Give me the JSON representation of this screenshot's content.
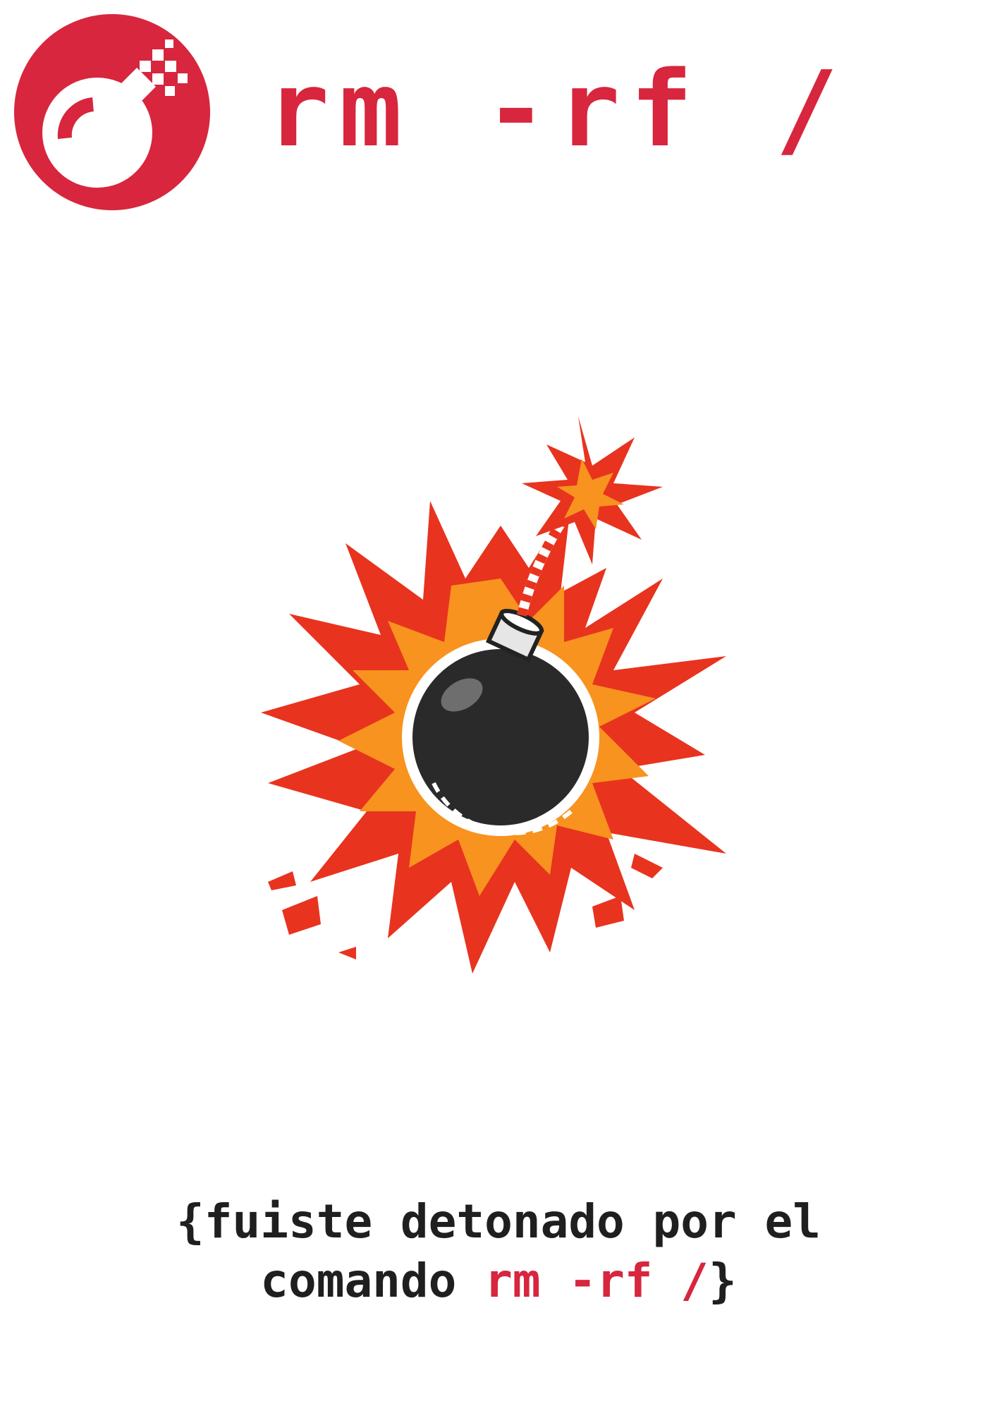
{
  "header": {
    "title": "rm -rf /",
    "logo_icon": "bomb-logo-icon"
  },
  "illustration": {
    "icon": "exploding-bomb-icon"
  },
  "caption": {
    "line1": "{fuiste detonado por el",
    "line2_prefix": "comando ",
    "line2_command": "rm -rf /",
    "line2_suffix": "}"
  },
  "colors": {
    "accent": "#d7263d",
    "text": "#1f1f1f",
    "burst_red": "#e8331f",
    "burst_orange": "#f7931e",
    "bomb": "#2a2a2a"
  }
}
